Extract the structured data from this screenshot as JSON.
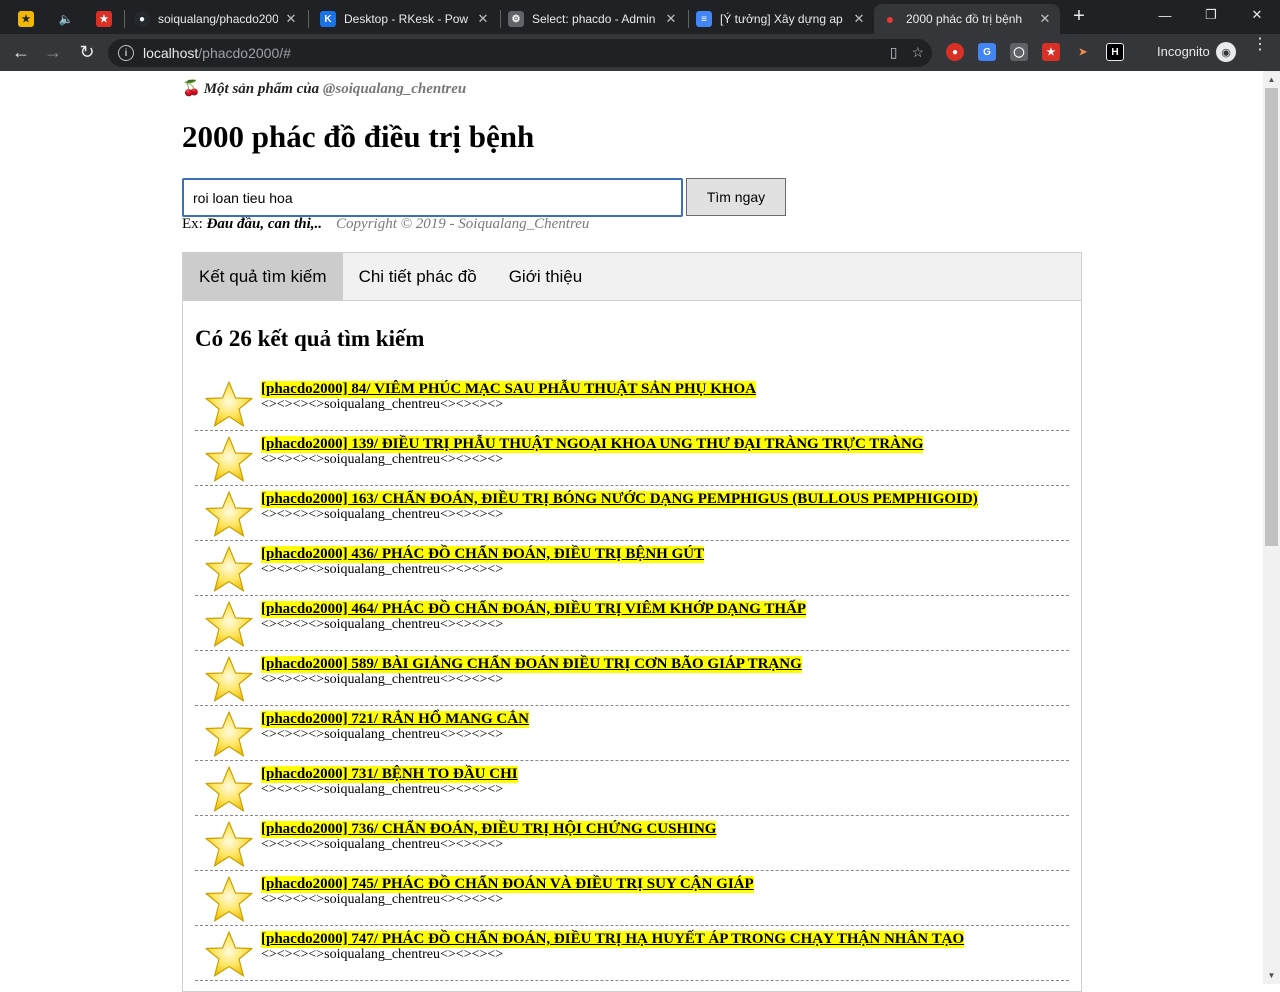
{
  "browser": {
    "tabs": [
      {
        "title": "",
        "icon": "bookmark-icon",
        "color": "#f2b705"
      },
      {
        "title": "",
        "icon": "speaker-icon",
        "color": "#202124"
      },
      {
        "title": "",
        "icon": "star-app-icon",
        "color": "#d93025"
      },
      {
        "title": "soiqualang/phacdo2000",
        "icon": "github-icon",
        "color": "#24292e"
      },
      {
        "title": "Desktop - RKesk - Pow",
        "icon": "k-app-icon",
        "color": "#1a73e8"
      },
      {
        "title": "Select: phacdo - Admin",
        "icon": "db-admin-icon",
        "color": "#5f6368"
      },
      {
        "title": "[Ý tưởng] Xây dựng ap",
        "icon": "docs-icon",
        "color": "#4285f4"
      },
      {
        "title": "2000 phác đồ trị bệnh",
        "icon": "cherry-icon",
        "color": "#c62828"
      }
    ],
    "url_host": "localhost",
    "url_path": "/phacdo2000/#",
    "profile": "Incognito"
  },
  "page": {
    "credit_prefix": "Một sản phẩm của ",
    "credit_handle": "@soiqualang_chentreu",
    "title": "2000 phác đồ điều trị bệnh",
    "search_value": "roi loan tieu hoa",
    "search_button": "Tìm ngay",
    "hint_label": "Ex: ",
    "hint_example": "Đau đầu, can thi,..",
    "copyright": "Copyright © 2019 - Soiqualang_Chentreu",
    "tabs": [
      "Kết quả tìm kiếm",
      "Chi tiết phác đồ",
      "Giới thiệu"
    ],
    "results_title": "Có 26 kết quả tìm kiếm",
    "results": [
      {
        "title": "[phacdo2000] 84/ VIÊM PHÚC MẠC SAU PHẪU THUẬT SẢN PHỤ KHOA",
        "sub": "<><><><>soiqualang_chentreu<><><><>"
      },
      {
        "title": "[phacdo2000] 139/ ĐIỀU TRỊ PHẪU THUẬT NGOẠI KHOA UNG THƯ ĐẠI TRÀNG TRỰC TRÀNG",
        "sub": "<><><><>soiqualang_chentreu<><><><>"
      },
      {
        "title": "[phacdo2000] 163/ CHẨN ĐOÁN, ĐIỀU TRỊ BÓNG NƯỚC DẠNG PEMPHIGUS (BULLOUS PEMPHIGOID)",
        "sub": "<><><><>soiqualang_chentreu<><><><>"
      },
      {
        "title": "[phacdo2000] 436/ PHÁC ĐỒ CHẨN ĐOÁN, ĐIỀU TRỊ BỆNH GÚT",
        "sub": "<><><><>soiqualang_chentreu<><><><>"
      },
      {
        "title": "[phacdo2000] 464/ PHÁC ĐỒ CHẨN ĐOÁN, ĐIỀU TRỊ VIÊM KHỚP DẠNG THẤP ",
        "sub": "<><><><>soiqualang_chentreu<><><><>"
      },
      {
        "title": "[phacdo2000] 589/ BÀI GIẢNG CHẨN ĐOÁN ĐIỀU TRỊ CƠN BÃO GIÁP TRẠNG",
        "sub": "<><><><>soiqualang_chentreu<><><><>"
      },
      {
        "title": "[phacdo2000] 721/ RẮN HỔ MANG CẮN",
        "sub": "<><><><>soiqualang_chentreu<><><><>"
      },
      {
        "title": "[phacdo2000] 731/ BỆNH TO ĐẦU CHI ",
        "sub": "<><><><>soiqualang_chentreu<><><><>"
      },
      {
        "title": "[phacdo2000] 736/ CHẨN ĐOÁN, ĐIỀU TRỊ HỘI CHỨNG CUSHING ",
        "sub": "<><><><>soiqualang_chentreu<><><><>"
      },
      {
        "title": "[phacdo2000] 745/ PHÁC ĐỒ CHẨN ĐOÁN VÀ ĐIỀU TRỊ SUY CẬN GIÁP ",
        "sub": "<><><><>soiqualang_chentreu<><><><>"
      },
      {
        "title": "[phacdo2000] 747/ PHÁC ĐỒ CHẨN ĐOÁN, ĐIỀU TRỊ HẠ HUYẾT ÁP TRONG CHẠY THẬN NHÂN TẠO ",
        "sub": "<><><><>soiqualang_chentreu<><><><>"
      }
    ]
  }
}
